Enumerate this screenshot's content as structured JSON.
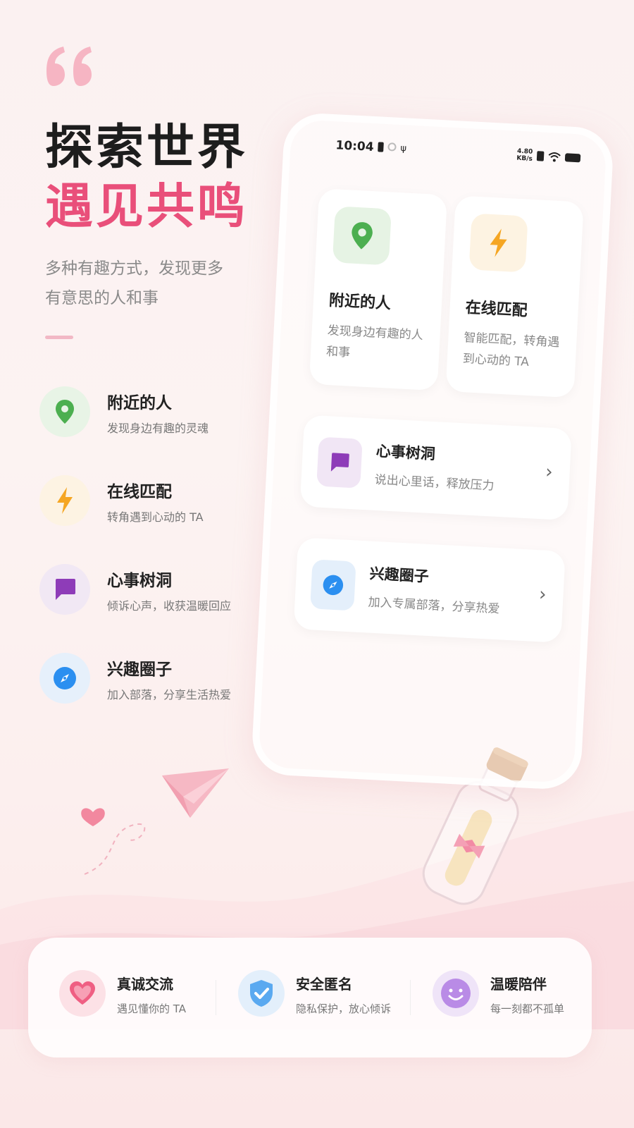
{
  "headline": {
    "line1": "探索世界",
    "line2": "遇见共鸣"
  },
  "subtitle": {
    "line1": "多种有趣方式，发现更多",
    "line2": "有意思的人和事"
  },
  "features": [
    {
      "title": "附近的人",
      "desc": "发现身边有趣的灵魂",
      "icon": "location-pin-icon",
      "color": "#4caf50"
    },
    {
      "title": "在线匹配",
      "desc": "转角遇到心动的 TA",
      "icon": "lightning-icon",
      "color": "#f5a623"
    },
    {
      "title": "心事树洞",
      "desc": "倾诉心声，收获温暖回应",
      "icon": "chat-bubble-icon",
      "color": "#8e3cb8"
    },
    {
      "title": "兴趣圈子",
      "desc": "加入部落，分享生活热爱",
      "icon": "compass-icon",
      "color": "#2b8ff0"
    }
  ],
  "phone": {
    "status": {
      "time": "10:04",
      "speed_value": "4.80",
      "speed_unit": "KB/s"
    },
    "cards": [
      {
        "title": "附近的人",
        "desc": "发现身边有趣的人和事",
        "icon": "location-pin-icon"
      },
      {
        "title": "在线匹配",
        "desc": "智能匹配，转角遇到心动的 TA",
        "icon": "lightning-icon"
      },
      {
        "title": "心事树洞",
        "desc": "说出心里话，释放压力",
        "icon": "chat-bubble-icon"
      },
      {
        "title": "兴趣圈子",
        "desc": "加入专属部落，分享热爱",
        "icon": "compass-icon"
      }
    ]
  },
  "bottom": [
    {
      "title": "真诚交流",
      "desc": "遇见懂你的 TA",
      "icon": "heart-icon"
    },
    {
      "title": "安全匿名",
      "desc": "隐私保护，放心倾诉",
      "icon": "shield-check-icon"
    },
    {
      "title": "温暖陪伴",
      "desc": "每一刻都不孤单",
      "icon": "smiley-icon"
    }
  ],
  "colors": {
    "accent": "#e94f7a",
    "background": "#fbf1f1"
  }
}
